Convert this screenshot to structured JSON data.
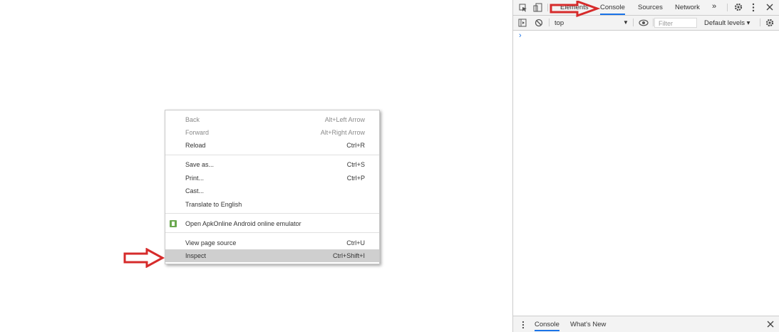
{
  "context_menu": {
    "items": [
      {
        "label": "Back",
        "shortcut": "Alt+Left Arrow"
      },
      {
        "label": "Forward",
        "shortcut": "Alt+Right Arrow"
      },
      {
        "label": "Reload",
        "shortcut": "Ctrl+R"
      },
      {
        "label": "Save as...",
        "shortcut": "Ctrl+S"
      },
      {
        "label": "Print...",
        "shortcut": "Ctrl+P"
      },
      {
        "label": "Cast...",
        "shortcut": ""
      },
      {
        "label": "Translate to English",
        "shortcut": ""
      },
      {
        "label": "Open ApkOnline Android online emulator",
        "shortcut": ""
      },
      {
        "label": "View page source",
        "shortcut": "Ctrl+U"
      },
      {
        "label": "Inspect",
        "shortcut": "Ctrl+Shift+I"
      }
    ]
  },
  "devtools": {
    "tabs": [
      "Elements",
      "Console",
      "Sources",
      "Network"
    ],
    "more": "»",
    "console_toolbar": {
      "context": "top",
      "filter_placeholder": "Filter",
      "levels": "Default levels ▾"
    },
    "prompt": "›",
    "drawer_tabs": [
      "Console",
      "What's New"
    ]
  },
  "colors": {
    "annotation_arrow": "#d62b2b",
    "active_tab": "#1a73e8",
    "apk_icon": "#6aa84f"
  }
}
